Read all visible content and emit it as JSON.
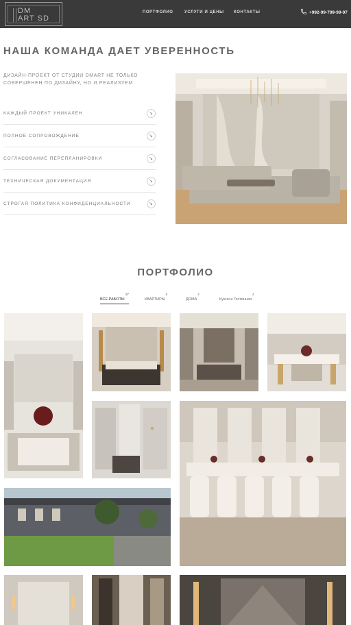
{
  "header": {
    "logo_line1": "DM",
    "logo_line2": "ART SD",
    "nav": [
      "ПОРТФОЛИО",
      "УСЛУГИ И ЦЕНЫ",
      "КОНТАКТЫ"
    ],
    "phone": "+992-99-799-99-97"
  },
  "intro": {
    "title": "НАША КОМАНДА ДАЕТ УВЕРЕННОСТЬ",
    "lead": "ДИЗАЙН-ПРОЕКТ ОТ СТУДИИ DMART НЕ ТОЛЬКО СОВЕРШЕНЕН ПО ДИЗАЙНУ, НО И РЕАЛИЗУЕМ",
    "features": [
      "КАЖДЫЙ ПРОЕКТ УНИКАЛЕН",
      "ПОЛНОЕ СОПРОВОЖДЕНИЕ",
      "СОГЛАСОВАНИЕ ПЕРЕПЛАНИРОВКИ",
      "ТЕХНИЧЕСКАЯ ДОКУМЕНТАЦИЯ",
      "СТРОГАЯ ПОЛИТИКА КОНФИДЕНЦИАЛЬНОСТИ"
    ]
  },
  "portfolio": {
    "title": "ПОРТФОЛИО",
    "tabs": [
      {
        "label": "ВСЕ РАБОТЫ",
        "count": "17"
      },
      {
        "label": "КВАРТИРЫ",
        "count": "6"
      },
      {
        "label": "ДОМА",
        "count": "2"
      },
      {
        "label": "Кухни и Гостинная",
        "count": "4"
      }
    ]
  },
  "icons": {
    "phone": "phone-icon",
    "feature_arrow": "arrow-down-right-icon"
  },
  "colors": {
    "header_bg": "#3a3a3a",
    "text": "#666666",
    "accent_gold": "#c9a56a"
  }
}
